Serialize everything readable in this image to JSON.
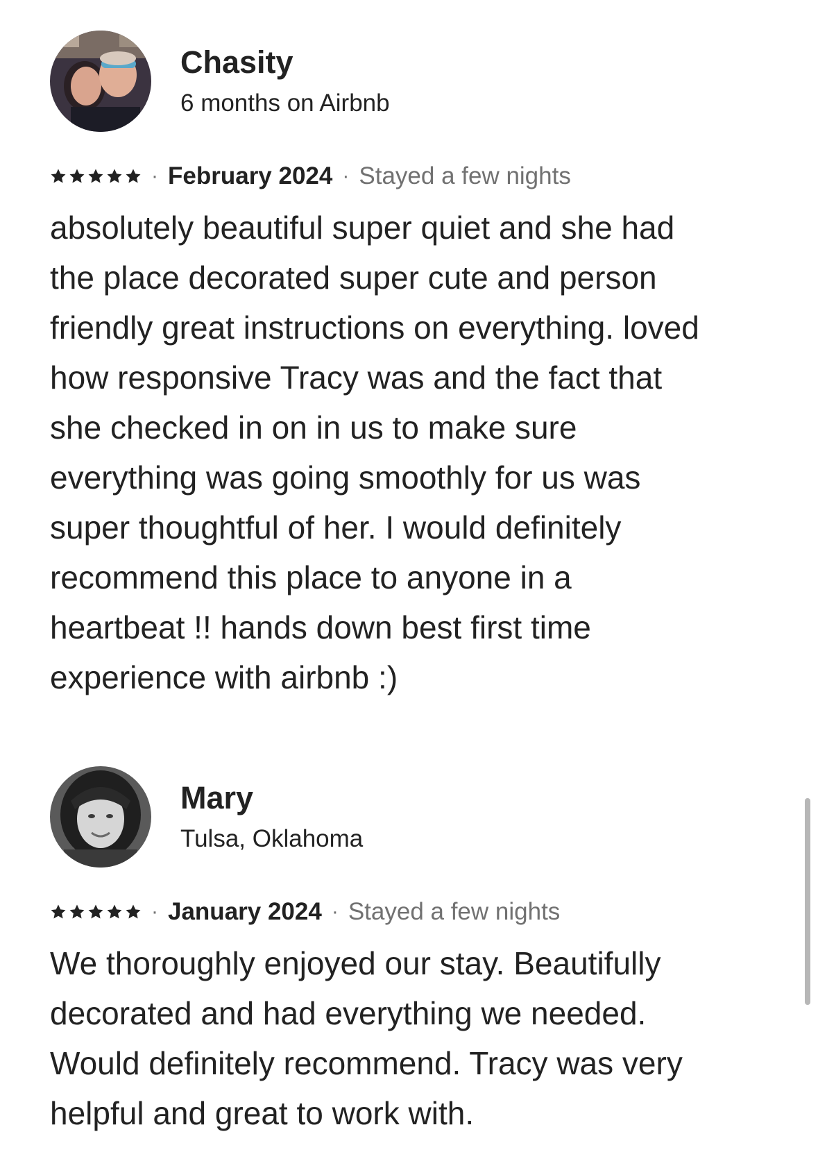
{
  "reviews": [
    {
      "name": "Chasity",
      "subtitle": "6 months on Airbnb",
      "rating": 5,
      "date": "February 2024",
      "stay": "Stayed a few nights",
      "text": "absolutely beautiful super quiet and she had\nthe place decorated super cute and person\nfriendly great instructions on everything. loved\nhow responsive Tracy was and the fact that\nshe checked in on in us to make sure\neverything was going smoothly for us was\nsuper thoughtful of her. I would definitely\nrecommend this place to anyone in a\nheartbeat !! hands down best first time\nexperience with airbnb :)"
    },
    {
      "name": "Mary",
      "subtitle": "Tulsa, Oklahoma",
      "rating": 5,
      "date": "January 2024",
      "stay": "Stayed a few nights",
      "text": "We thoroughly enjoyed our stay.  Beautifully\ndecorated and had everything we needed.\nWould definitely recommend.  Tracy was very\nhelpful and great to work with."
    }
  ],
  "separator": "·",
  "icons": {
    "star": "star-icon",
    "avatar_1": "avatar",
    "avatar_2": "avatar"
  },
  "colors": {
    "text": "#222222",
    "muted": "#717171",
    "scrollbar": "#b7b7b7"
  }
}
